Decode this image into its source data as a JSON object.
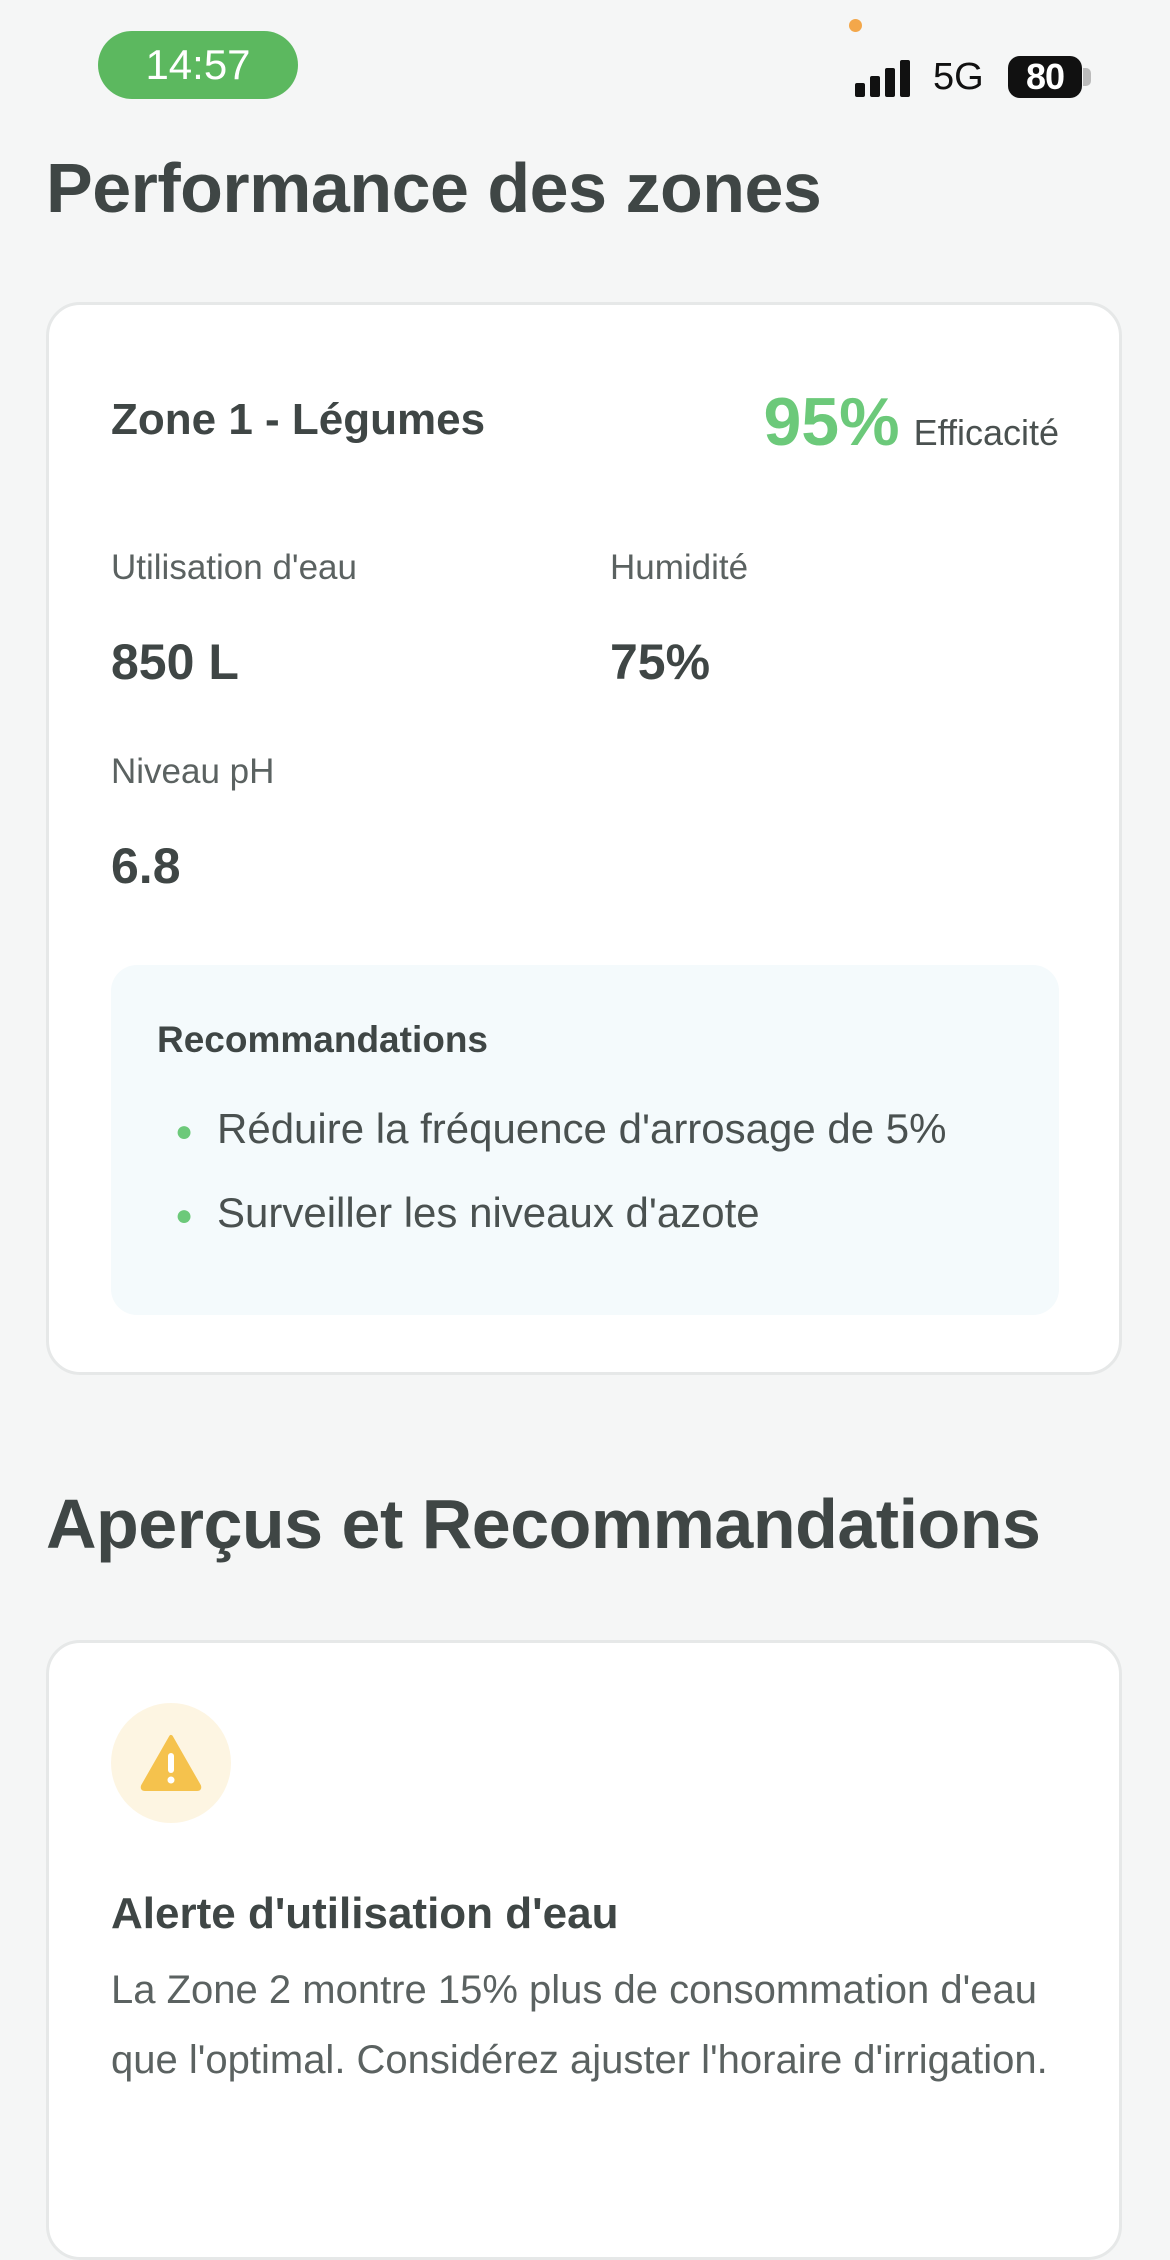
{
  "status_bar": {
    "time": "14:57",
    "network": "5G",
    "battery": "80"
  },
  "zones_section": {
    "title": "Performance des zones",
    "zone": {
      "name": "Zone 1 - Légumes",
      "efficiency_value": "95%",
      "efficiency_label": "Efficacité",
      "metrics": [
        {
          "label": "Utilisation d'eau",
          "value": "850 L"
        },
        {
          "label": "Humidité",
          "value": "75%"
        },
        {
          "label": "Niveau pH",
          "value": "6.8"
        }
      ],
      "recommendations": {
        "title": "Recommandations",
        "items": [
          "Réduire la fréquence d'arrosage de 5%",
          "Surveiller les niveaux d'azote"
        ]
      }
    }
  },
  "insights_section": {
    "title": "Aperçus et Recommandations",
    "alert": {
      "icon": "warning-icon",
      "title": "Alerte d'utilisation d'eau",
      "description": "La Zone 2 montre 15% plus de consommation d'eau que l'optimal. Considérez ajuster l'horaire d'irrigation."
    }
  },
  "colors": {
    "accent_green": "#6cc97a",
    "time_pill": "#5cb85f",
    "warning_yellow": "#f5c24d",
    "warning_bg": "#fdf5e2"
  }
}
